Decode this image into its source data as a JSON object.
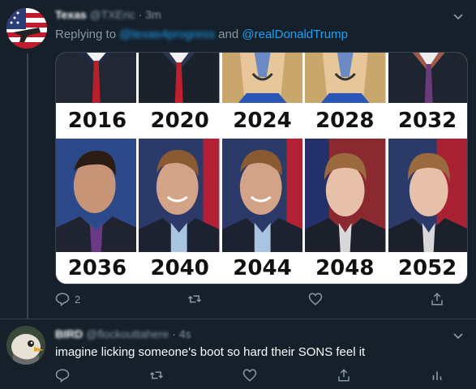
{
  "tweet1": {
    "display_name": "Texas",
    "handle": "@TXEric",
    "separator": "·",
    "time": "3m",
    "replying_prefix": "Replying to",
    "replying_user1": "@texas4progress",
    "replying_and": "and",
    "replying_user2": "@realDonaldTrump",
    "image": {
      "top_years": [
        "2016",
        "2020",
        "2024",
        "2028",
        "2032"
      ],
      "bottom_years": [
        "2036",
        "2040",
        "2044",
        "2048",
        "2052"
      ]
    },
    "reply_count": "2",
    "icons": [
      "reply-icon",
      "retweet-icon",
      "like-icon",
      "share-icon"
    ]
  },
  "tweet2": {
    "display_name": "BIRD",
    "handle": "@flockouttahere",
    "separator": "·",
    "time": "4s",
    "text": "imagine licking someone's boot so hard their SONS feel it",
    "icons": [
      "reply-icon",
      "retweet-icon",
      "like-icon",
      "share-icon",
      "analytics-icon"
    ]
  },
  "colors": {
    "background": "#15202b",
    "muted": "#8899a6",
    "accent": "#1da1f2",
    "divider": "#38444d"
  }
}
